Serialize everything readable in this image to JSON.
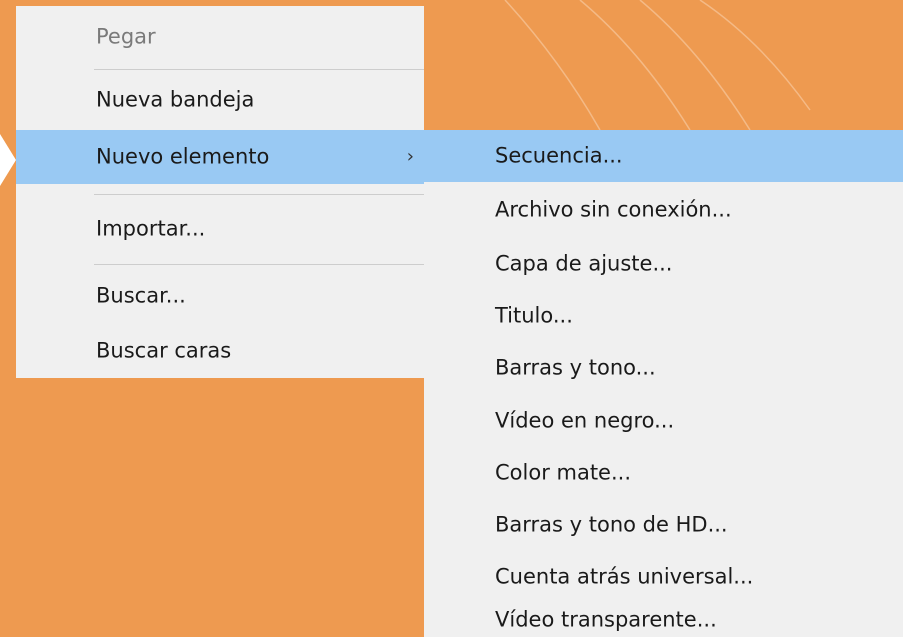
{
  "context_menu": {
    "items": [
      {
        "label": "Pegar",
        "enabled": false
      },
      {
        "label": "Nueva bandeja",
        "enabled": true
      },
      {
        "label": "Nuevo elemento",
        "enabled": true,
        "highlighted": true,
        "has_submenu": true
      },
      {
        "label": "Importar...",
        "enabled": true
      },
      {
        "label": "Buscar...",
        "enabled": true
      },
      {
        "label": "Buscar caras",
        "enabled": true
      }
    ],
    "submenu_arrow": "›"
  },
  "submenu": {
    "items": [
      {
        "label": "Secuencia...",
        "highlighted": true
      },
      {
        "label": "Archivo sin conexión..."
      },
      {
        "label": "Capa de ajuste..."
      },
      {
        "label": "Titulo..."
      },
      {
        "label": "Barras y tono..."
      },
      {
        "label": "Vídeo en negro..."
      },
      {
        "label": "Color mate..."
      },
      {
        "label": "Barras y tono de HD..."
      },
      {
        "label": "Cuenta atrás universal..."
      },
      {
        "label": "Vídeo transparente..."
      }
    ]
  },
  "colors": {
    "background": "#ee9a50",
    "menu": "#f0f0f0",
    "highlight": "#99c9f3"
  }
}
